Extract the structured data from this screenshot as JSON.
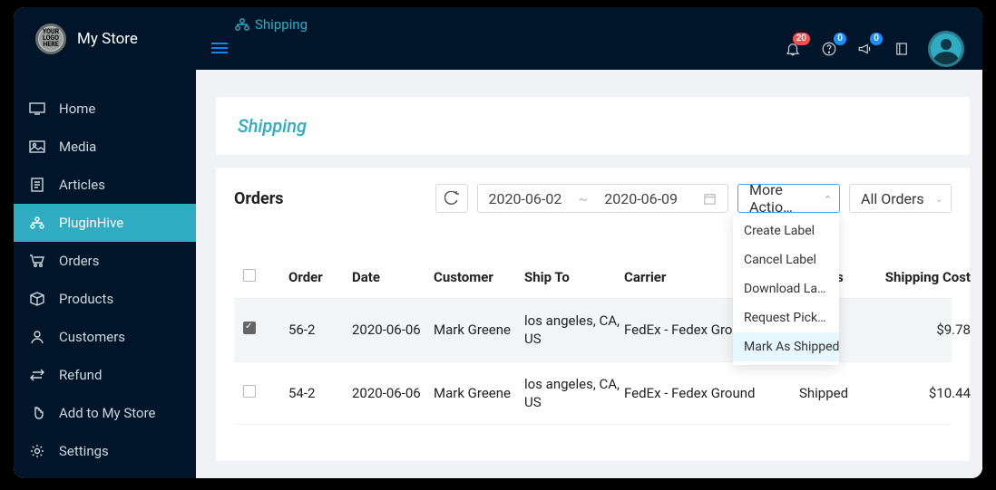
{
  "store_name": "My Store",
  "logo_text": "YOUR LOGO HERE",
  "breadcrumb": "Shipping",
  "notifications": {
    "bell": "20",
    "help": "0",
    "announce": "0"
  },
  "sidebar": {
    "items": [
      {
        "label": "Home"
      },
      {
        "label": "Media"
      },
      {
        "label": "Articles"
      },
      {
        "label": "PluginHive"
      },
      {
        "label": "Orders"
      },
      {
        "label": "Products"
      },
      {
        "label": "Customers"
      },
      {
        "label": "Refund"
      },
      {
        "label": "Add to My Store"
      },
      {
        "label": "Settings"
      }
    ]
  },
  "page_title": "Shipping",
  "orders": {
    "title": "Orders",
    "date_start": "2020-06-02",
    "date_end": "2020-06-09",
    "more_label": "More Actio…",
    "filter_label": "All Orders",
    "columns": [
      "Order",
      "Date",
      "Customer",
      "Ship To",
      "Carrier",
      "Status",
      "Shipping Cost"
    ],
    "rows": [
      {
        "order": "56-2",
        "date": "2020-06-06",
        "customer": "Mark Greene",
        "shipto": "los angeles, CA, US",
        "carrier": "FedEx - Fedex Ground",
        "status": "",
        "cost": "$9.78",
        "checked": true
      },
      {
        "order": "54-2",
        "date": "2020-06-06",
        "customer": "Mark Greene",
        "shipto": "los angeles, CA, US",
        "carrier": "FedEx - Fedex Ground",
        "status": "Shipped",
        "cost": "$10.44",
        "checked": false
      }
    ]
  },
  "actions_menu": [
    "Create Label",
    "Cancel Label",
    "Download La…",
    "Request Pick…",
    "Mark As Shipped"
  ]
}
